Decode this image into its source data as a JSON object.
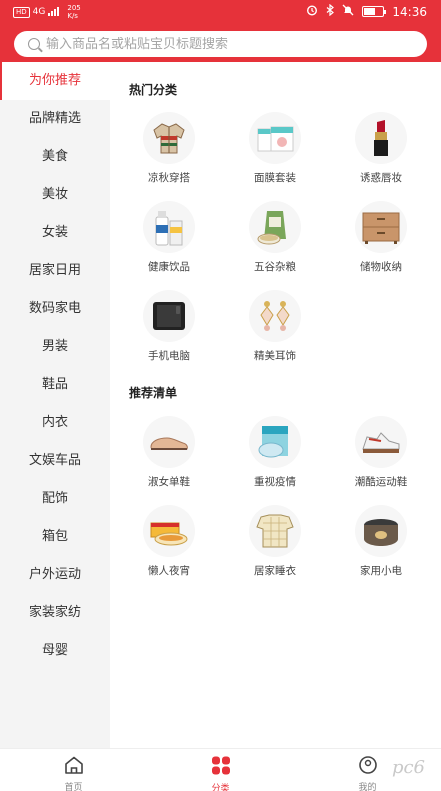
{
  "status_bar": {
    "sim1": "HD",
    "signal": "4G",
    "speed_value": "205",
    "speed_unit": "K/s",
    "time": "14:36",
    "battery_level": 0.6
  },
  "search": {
    "placeholder": "输入商品名或粘贴宝贝标题搜索"
  },
  "sidebar": {
    "items": [
      {
        "label": "为你推荐",
        "active": true
      },
      {
        "label": "品牌精选"
      },
      {
        "label": "美食"
      },
      {
        "label": "美妆"
      },
      {
        "label": "女装"
      },
      {
        "label": "居家日用"
      },
      {
        "label": "数码家电"
      },
      {
        "label": "男装"
      },
      {
        "label": "鞋品"
      },
      {
        "label": "内衣"
      },
      {
        "label": "文娱车品"
      },
      {
        "label": "配饰"
      },
      {
        "label": "箱包"
      },
      {
        "label": "户外运动"
      },
      {
        "label": "家装家纺"
      },
      {
        "label": "母婴"
      }
    ]
  },
  "hot": {
    "title": "热门分类",
    "items": [
      {
        "label": "凉秋穿搭",
        "icon": "jacket-icon"
      },
      {
        "label": "面膜套装",
        "icon": "facemask-box-icon"
      },
      {
        "label": "诱惑唇妆",
        "icon": "lipstick-icon"
      },
      {
        "label": "健康饮品",
        "icon": "drink-bottle-icon"
      },
      {
        "label": "五谷杂粮",
        "icon": "grain-bag-icon"
      },
      {
        "label": "储物收纳",
        "icon": "drawer-cabinet-icon"
      },
      {
        "label": "手机电脑",
        "icon": "phone-icon"
      },
      {
        "label": "精美耳饰",
        "icon": "earring-icon"
      }
    ]
  },
  "recommend": {
    "title": "推荐清单",
    "items": [
      {
        "label": "淑女单鞋",
        "icon": "loafer-shoe-icon"
      },
      {
        "label": "重视疫情",
        "icon": "mask-box-icon"
      },
      {
        "label": "潮酷运动鞋",
        "icon": "sneaker-icon"
      },
      {
        "label": "懒人夜宵",
        "icon": "instant-food-icon"
      },
      {
        "label": "居家睡衣",
        "icon": "pajamas-icon"
      },
      {
        "label": "家用小电",
        "icon": "rice-cooker-icon"
      }
    ]
  },
  "bottom_nav": {
    "home": "首页",
    "category": "分类",
    "mine": "我的"
  },
  "watermark": "pc6",
  "colors": {
    "accent": "#e6323a",
    "sidebar_bg": "#f4f4f4"
  }
}
